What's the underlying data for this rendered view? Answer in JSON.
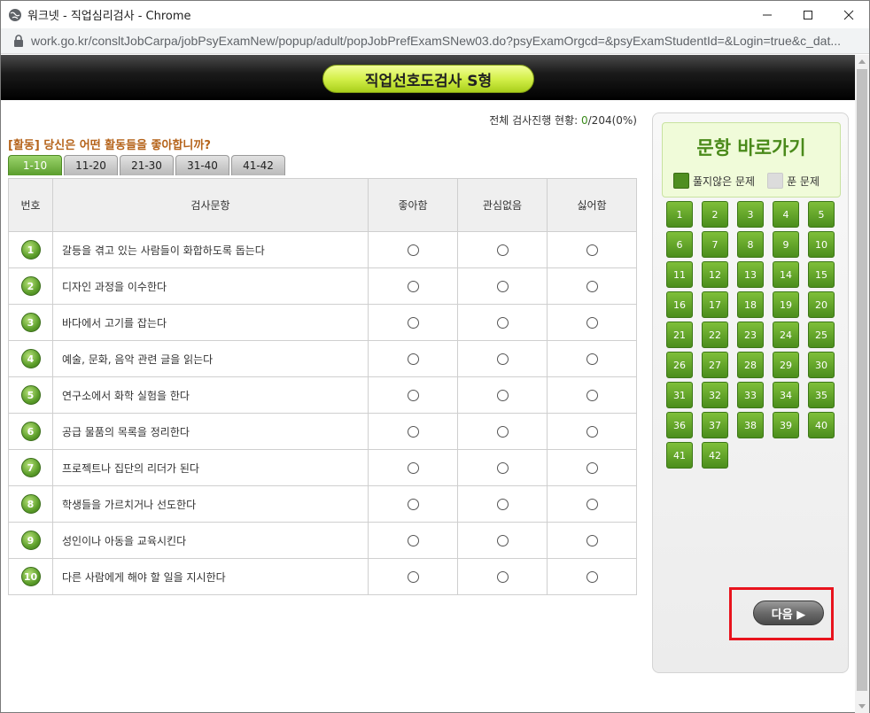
{
  "window": {
    "title": "워크넷 - 직업심리검사 - Chrome",
    "url": "work.go.kr/consltJobCarpa/jobPsyExamNew/popup/adult/popJobPrefExamSNew03.do?psyExamOrgcd=&psyExamStudentId=&Login=true&c_dat..."
  },
  "header": {
    "title": "직업선호도검사 S형"
  },
  "progress": {
    "label": "전체 검사진행 현황: ",
    "current": "0",
    "rest": "/204(0%)"
  },
  "question": "[활동] 당신은 어떤 활동들을 좋아합니까?",
  "tabs": [
    "1-10",
    "11-20",
    "21-30",
    "31-40",
    "41-42"
  ],
  "table": {
    "headers": {
      "no": "번호",
      "item": "검사문항",
      "like": "좋아함",
      "neutral": "관심없음",
      "dislike": "싫어함"
    },
    "rows": [
      {
        "no": "1",
        "text": "갈등을 겪고 있는 사람들이 화합하도록 돕는다"
      },
      {
        "no": "2",
        "text": "디자인 과정을 이수한다"
      },
      {
        "no": "3",
        "text": "바다에서 고기를 잡는다"
      },
      {
        "no": "4",
        "text": "예술, 문화, 음악 관련 글을 읽는다"
      },
      {
        "no": "5",
        "text": "연구소에서 화학 실험을 한다"
      },
      {
        "no": "6",
        "text": "공급 물품의 목록을 정리한다"
      },
      {
        "no": "7",
        "text": "프로젝트나 집단의 리더가 된다"
      },
      {
        "no": "8",
        "text": "학생들을 가르치거나 선도한다"
      },
      {
        "no": "9",
        "text": "성인이나 아동을 교육시킨다"
      },
      {
        "no": "10",
        "text": "다른 사람에게 해야 할 일을 지시한다"
      }
    ]
  },
  "panel": {
    "title": "문항 바로가기",
    "legend_unanswered": "풀지않은 문제",
    "legend_answered": "푼 문제",
    "numbers": [
      "1",
      "2",
      "3",
      "4",
      "5",
      "6",
      "7",
      "8",
      "9",
      "10",
      "11",
      "12",
      "13",
      "14",
      "15",
      "16",
      "17",
      "18",
      "19",
      "20",
      "21",
      "22",
      "23",
      "24",
      "25",
      "26",
      "27",
      "28",
      "29",
      "30",
      "31",
      "32",
      "33",
      "34",
      "35",
      "36",
      "37",
      "38",
      "39",
      "40",
      "41",
      "42"
    ],
    "next_label": "다음 ▶"
  },
  "colors": {
    "accent_green": "#4f8e20",
    "highlight_red": "#e8131d",
    "question_orange": "#b5631a"
  }
}
